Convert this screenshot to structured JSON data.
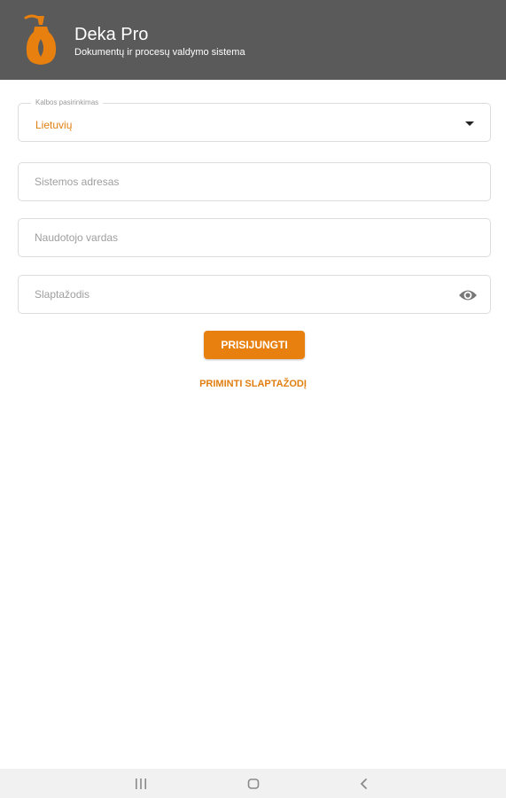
{
  "header": {
    "title": "Deka Pro",
    "subtitle": "Dokumentų ir procesų valdymo sistema",
    "logo_icon": "bottle-logo-icon",
    "background_color": "#5a5a5a",
    "accent_color": "#e8800f"
  },
  "form": {
    "language": {
      "label": "Kalbos pasirinkimas",
      "value": "Lietuvių"
    },
    "system_address": {
      "placeholder": "Sistemos adresas",
      "value": ""
    },
    "username": {
      "placeholder": "Naudotojo vardas",
      "value": ""
    },
    "password": {
      "placeholder": "Slaptažodis",
      "value": "",
      "toggle_icon": "eye-icon"
    },
    "login_button": "PRISIJUNGTI",
    "remind_link": "PRIMINTI SLAPTAŽODĮ"
  },
  "navbar": {
    "icons": [
      "recent-apps-icon",
      "home-icon",
      "back-icon"
    ]
  }
}
